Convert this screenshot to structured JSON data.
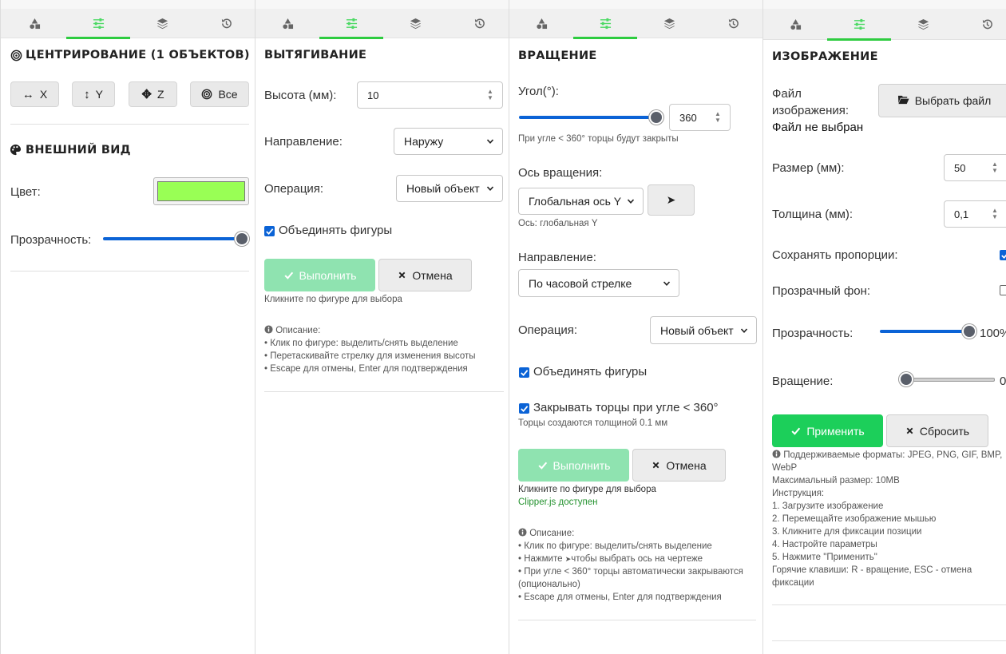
{
  "tab_icons": [
    "shapes-icon",
    "sliders-icon",
    "layers-icon",
    "history-icon"
  ],
  "accent": "#2ecc40",
  "panel1": {
    "centering_title": "ЦЕНТРИРОВАНИЕ (1 ОБЪЕКТОВ)",
    "btn_x": "X",
    "btn_y": "Y",
    "btn_z": "Z",
    "btn_all": "Все",
    "appearance_title": "ВНЕШНИЙ ВИД",
    "color_label": "Цвет:",
    "color_value": "#99ff55",
    "opacity_label": "Прозрачность:",
    "opacity_value": 1.0
  },
  "panel2": {
    "title": "ВЫТЯГИВАНИЕ",
    "height_label": "Высота (мм):",
    "height_value": "10",
    "direction_label": "Направление:",
    "direction_value": "Наружу",
    "operation_label": "Операция:",
    "operation_value": "Новый объект",
    "merge_label": "Объединять фигуры",
    "merge_checked": true,
    "execute_label": "Выполнить",
    "cancel_label": "Отмена",
    "hint": "Кликните по фигуре для выбора",
    "desc_title": "Описание:",
    "desc_lines": [
      "• Клик по фигуре: выделить/снять выделение",
      "• Перетаскивайте стрелку для изменения высоты",
      "• Escape для отмены, Enter для подтверждения"
    ]
  },
  "panel3": {
    "title": "ВРАЩЕНИЕ",
    "angle_label": "Угол(°):",
    "angle_value": "360",
    "angle_fraction": 1.0,
    "angle_hint": "При угле < 360° торцы будут закрыты",
    "axis_label": "Ось вращения:",
    "axis_value": "Глобальная ось Y",
    "axis_hint": "Ось: глобальная Y",
    "direction_label": "Направление:",
    "direction_value": "По часовой стрелке",
    "operation_label": "Операция:",
    "operation_value": "Новый объект",
    "merge_label": "Объединять фигуры",
    "close_label": "Закрывать торцы при угле < 360°",
    "close_hint": "Торцы создаются толщиной 0.1 мм",
    "execute_label": "Выполнить",
    "cancel_label": "Отмена",
    "hint": "Кликните по фигуре для выбора",
    "clipper": "Clipper.js доступен",
    "desc_title": "Описание:",
    "desc_lines": [
      "• Клик по фигуре: выделить/снять выделение",
      "• Нажмите",
      "чтобы выбрать ось на чертеже",
      "• При угле < 360° торцы автоматически закрываются",
      "(опционально)",
      "• Escape для отмены, Enter для подтверждения"
    ]
  },
  "panel4": {
    "title": "ИЗОБРАЖЕНИЕ",
    "file_label_1": "Файл",
    "file_label_2": "изображения:",
    "file_none": "Файл не выбран",
    "choose_label": "Выбрать файл",
    "size_label": "Размер (мм):",
    "size_value": "50",
    "thickness_label": "Толщина (мм):",
    "thickness_value": "0,1",
    "keep_label": "Сохранять пропорции:",
    "keep_checked": true,
    "transparent_label": "Прозрачный фон:",
    "transparent_checked": false,
    "opacity_label": "Прозрачность:",
    "opacity_text": "100%",
    "opacity_fraction": 1.0,
    "rotation_label": "Вращение:",
    "rotation_text": "0",
    "rotation_fraction": 0.0,
    "apply_label": "Применить",
    "reset_label": "Сбросить",
    "info_lines": [
      "Поддерживаемые форматы: JPEG, PNG, GIF, BMP,",
      "WebP",
      "Максимальный размер: 10MB",
      "Инструкция:",
      "1. Загрузите изображение",
      "2. Перемещайте изображение мышью",
      "3. Кликните для фиксации позиции",
      "4. Настройте параметры",
      "5. Нажмите \"Применить\"",
      "Горячие клавиши: R - вращение, ESC - отмена",
      "фиксации"
    ]
  }
}
